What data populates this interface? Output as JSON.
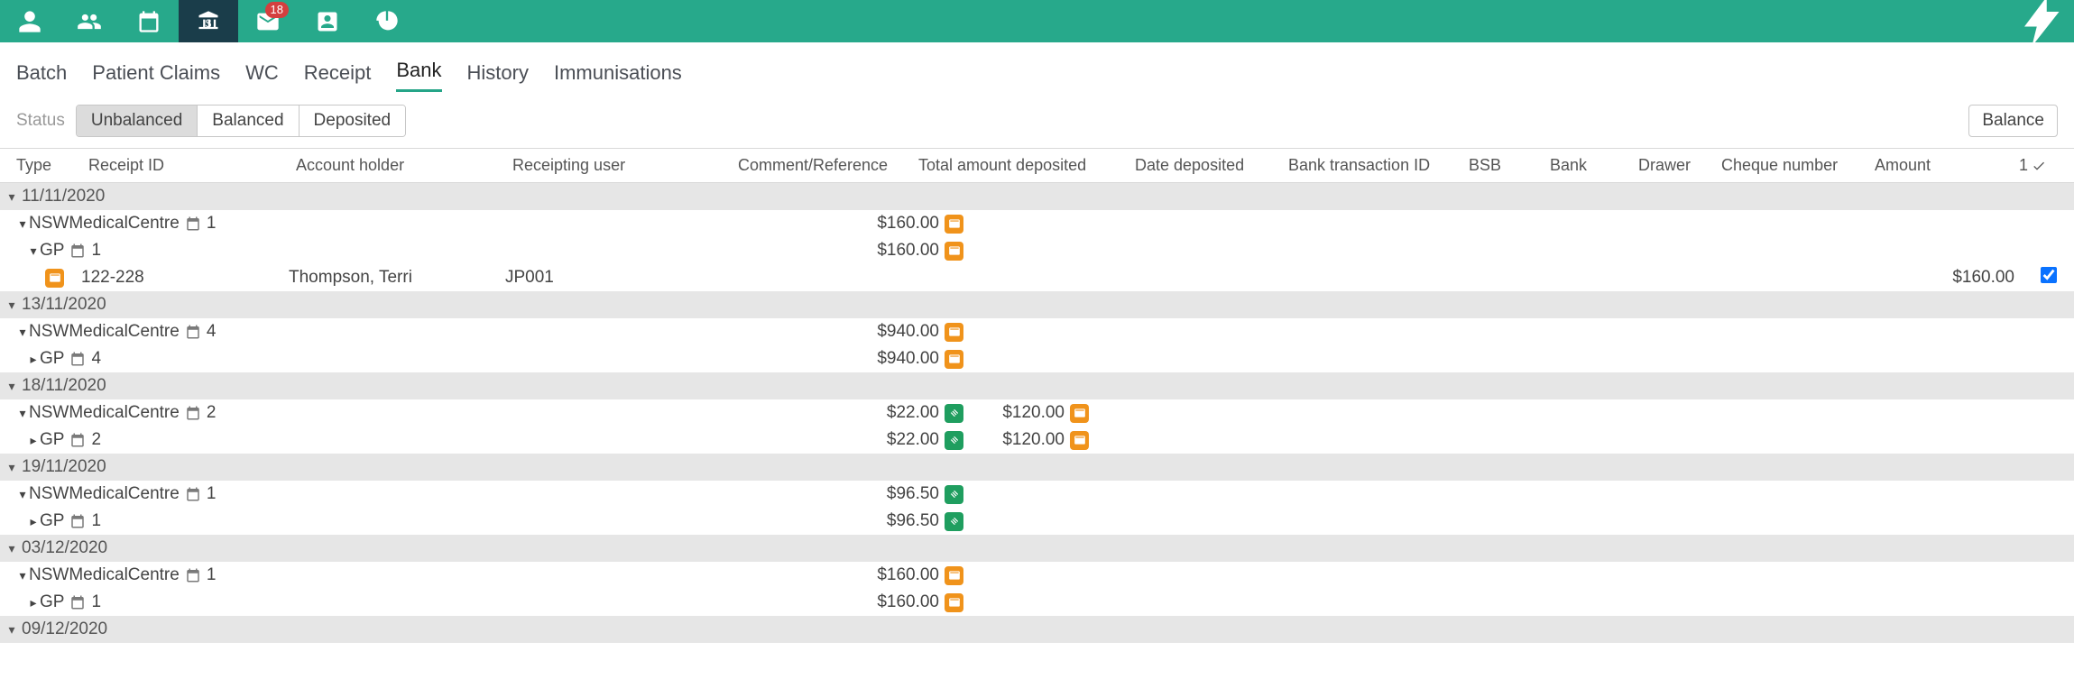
{
  "topbar": {
    "badge_count": "18"
  },
  "nav": {
    "tabs": [
      "Batch",
      "Patient Claims",
      "WC",
      "Receipt",
      "Bank",
      "History",
      "Immunisations"
    ],
    "active": "Bank"
  },
  "status": {
    "label": "Status",
    "pills": [
      "Unbalanced",
      "Balanced",
      "Deposited"
    ],
    "active": "Unbalanced",
    "balance_btn": "Balance"
  },
  "columns": {
    "type": "Type",
    "receipt_id": "Receipt ID",
    "holder": "Account holder",
    "recuser": "Receipting user",
    "comment": "Comment/Reference",
    "total": "Total amount deposited",
    "datedep": "Date deposited",
    "banktx": "Bank transaction ID",
    "bsb": "BSB",
    "bank": "Bank",
    "drawer": "Drawer",
    "cheque": "Cheque number",
    "amount": "Amount",
    "checkcount": "1"
  },
  "groups": [
    {
      "date": "11/11/2020",
      "expanded": true,
      "centres": [
        {
          "name": "NSWMedicalCentre",
          "count": "1",
          "expanded": true,
          "amounts": [
            {
              "value": "$160.00",
              "chip": "orange"
            }
          ],
          "gps": [
            {
              "name": "GP",
              "count": "1",
              "expanded": true,
              "amounts": [
                {
                  "value": "$160.00",
                  "chip": "orange"
                }
              ],
              "details": [
                {
                  "receipt_id": "122-228",
                  "holder": "Thompson, Terri",
                  "recuser": "JP001",
                  "amount": "$160.00",
                  "checked": true,
                  "chip": "orange"
                }
              ]
            }
          ]
        }
      ]
    },
    {
      "date": "13/11/2020",
      "expanded": true,
      "centres": [
        {
          "name": "NSWMedicalCentre",
          "count": "4",
          "expanded": true,
          "amounts": [
            {
              "value": "$940.00",
              "chip": "orange"
            }
          ],
          "gps": [
            {
              "name": "GP",
              "count": "4",
              "expanded": false,
              "amounts": [
                {
                  "value": "$940.00",
                  "chip": "orange"
                }
              ],
              "details": []
            }
          ]
        }
      ]
    },
    {
      "date": "18/11/2020",
      "expanded": true,
      "centres": [
        {
          "name": "NSWMedicalCentre",
          "count": "2",
          "expanded": true,
          "amounts": [
            {
              "value": "$22.00",
              "chip": "green"
            },
            {
              "value": "$120.00",
              "chip": "orange"
            }
          ],
          "gps": [
            {
              "name": "GP",
              "count": "2",
              "expanded": false,
              "amounts": [
                {
                  "value": "$22.00",
                  "chip": "green"
                },
                {
                  "value": "$120.00",
                  "chip": "orange"
                }
              ],
              "details": []
            }
          ]
        }
      ]
    },
    {
      "date": "19/11/2020",
      "expanded": true,
      "centres": [
        {
          "name": "NSWMedicalCentre",
          "count": "1",
          "expanded": true,
          "amounts": [
            {
              "value": "$96.50",
              "chip": "green"
            }
          ],
          "gps": [
            {
              "name": "GP",
              "count": "1",
              "expanded": false,
              "amounts": [
                {
                  "value": "$96.50",
                  "chip": "green"
                }
              ],
              "details": []
            }
          ]
        }
      ]
    },
    {
      "date": "03/12/2020",
      "expanded": true,
      "centres": [
        {
          "name": "NSWMedicalCentre",
          "count": "1",
          "expanded": true,
          "amounts": [
            {
              "value": "$160.00",
              "chip": "orange"
            }
          ],
          "gps": [
            {
              "name": "GP",
              "count": "1",
              "expanded": false,
              "amounts": [
                {
                  "value": "$160.00",
                  "chip": "orange"
                }
              ],
              "details": []
            }
          ]
        }
      ]
    },
    {
      "date": "09/12/2020",
      "expanded": true,
      "centres": []
    }
  ]
}
